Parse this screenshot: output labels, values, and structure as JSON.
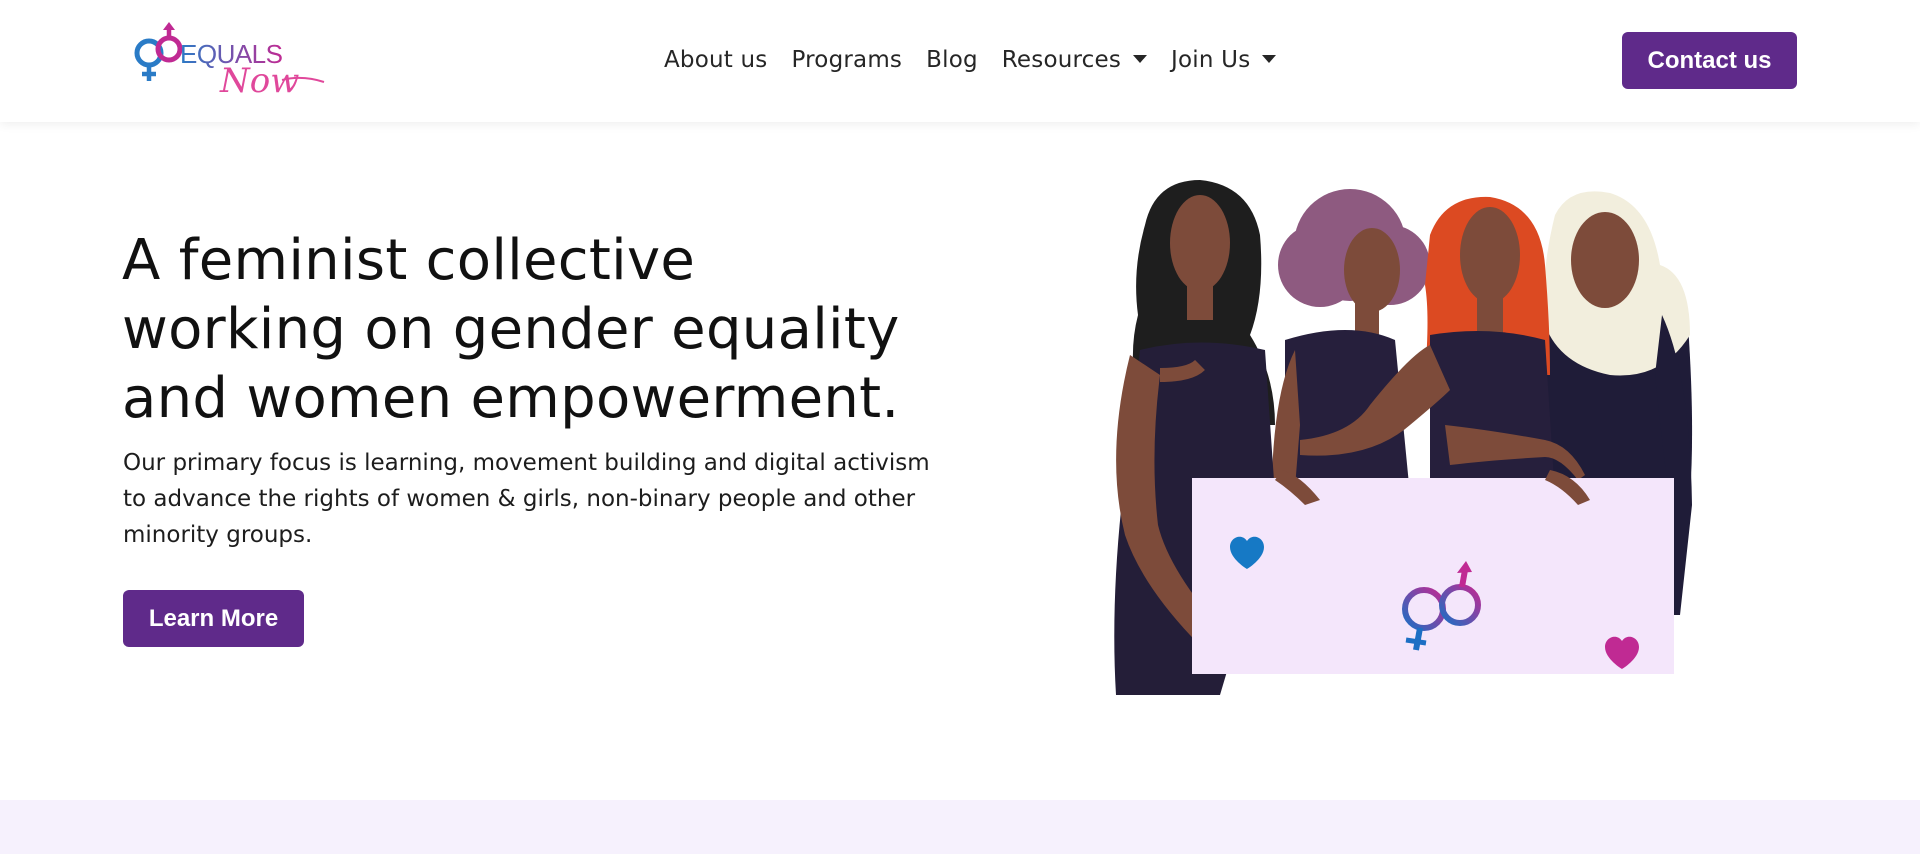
{
  "header": {
    "logo_text": "EQUALS Now",
    "nav": [
      {
        "label": "About us"
      },
      {
        "label": "Programs"
      },
      {
        "label": "Blog"
      },
      {
        "label": "Resources",
        "dropdown": true
      },
      {
        "label": "Join Us",
        "dropdown": true
      }
    ],
    "contact_label": "Contact us"
  },
  "hero": {
    "title_lines": [
      "A feminist collective",
      "working on gender equality",
      "and women empowerment."
    ],
    "description": "Our primary focus is learning, movement building and digital activism to advance the rights of women & girls, non-binary people and other minority groups.",
    "button_label": "Learn More"
  },
  "colors": {
    "brand_purple": "#5f2a8a",
    "band_lavender": "#f6f1fd",
    "sign_background": "#f4e6fb",
    "heart_blue": "#1679c5",
    "heart_magenta": "#c02a93"
  },
  "icons": [
    "equals-now-logo",
    "chevron-down-icon",
    "heart-icon",
    "gender-symbol-icon"
  ]
}
